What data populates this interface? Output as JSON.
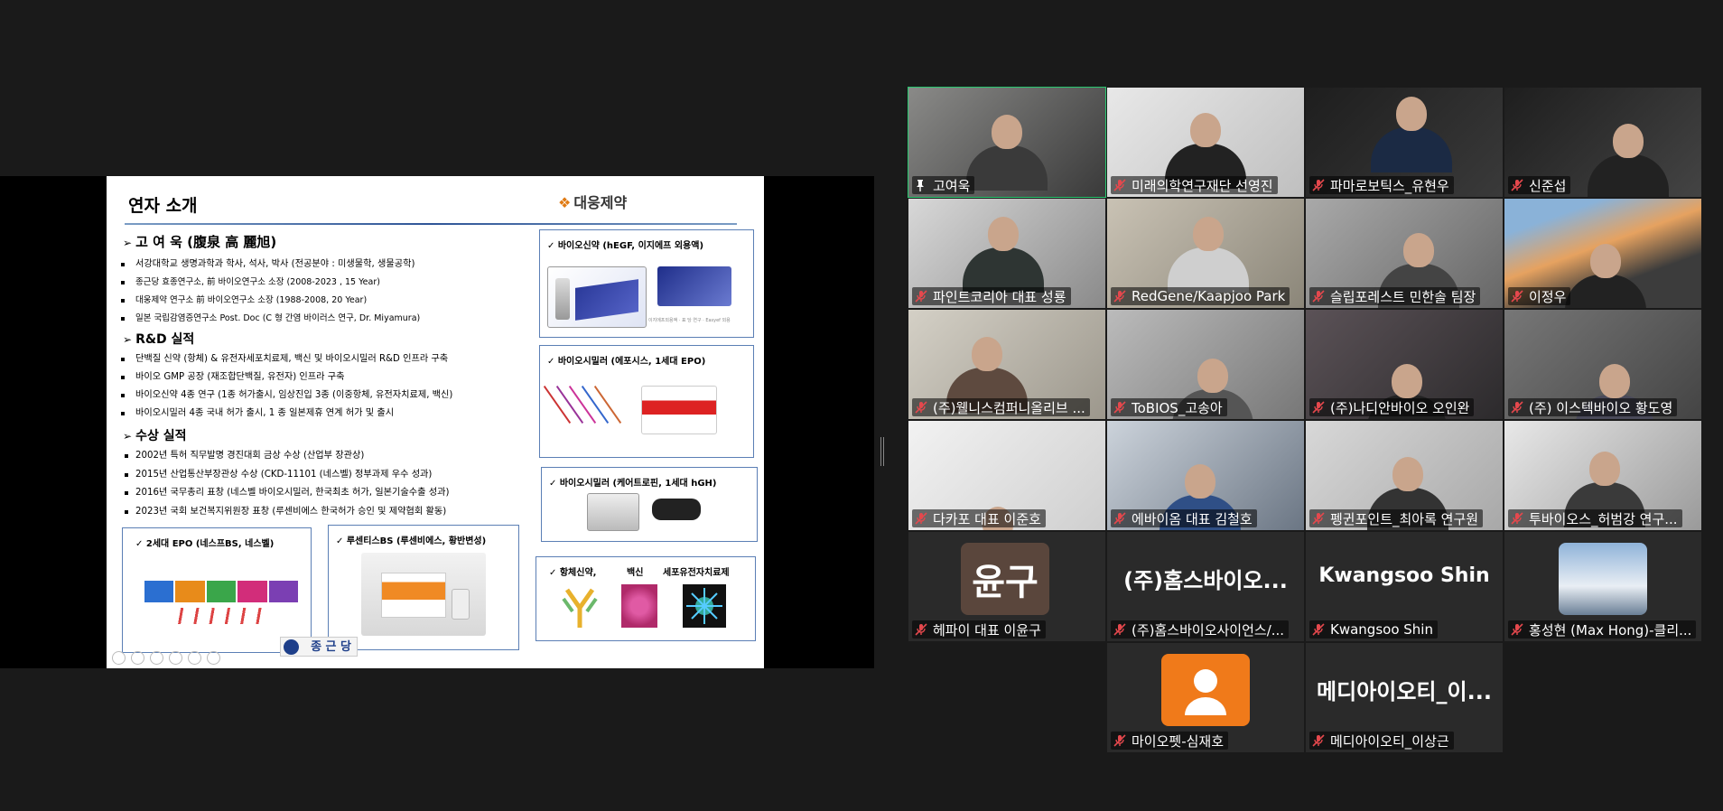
{
  "slide": {
    "title": "연자 소개",
    "company_logo": "대웅제약",
    "sections": [
      {
        "heading": "고  여  욱  (腹泉 高 麗旭)"
      },
      {
        "heading": "R&D 실적"
      },
      {
        "heading": "수상 실적"
      }
    ],
    "profile_items": [
      "서강대학교 생명과학과 학사, 석사, 박사  (전공분야 : 미생물학, 생물공학)",
      "종근당 효종연구소, 前 바이오연구소 소장 (2008-2023 , 15 Year)",
      "대웅제약 연구소 前 바이오연구소 소장  (1988-2008, 20 Year)",
      "일본 국립감염증연구소 Post. Doc (C 형 간염 바이러스 연구, Dr. Miyamura)"
    ],
    "rnd_items": [
      "단백질 신약 (항체) &  유전자세포치료제, 백신 및  바이오시밀러  R&D 인프라 구축",
      " 바이오 GMP  공장 (재조합단백질, 유전자)  인프라 구축",
      " 바이오신약  4종 연구 (1종 허가출시, 임상진입 3종 (이중항체, 유전자치료제, 백신)",
      " 바이오시밀러  4종  국내 허가 출시, 1 종 일본제휴 연계  허가 및 출시"
    ],
    "award_items": [
      "2002년 특허 직무발명 경진대회 금상 수상 (산업부 장관상)",
      "2015년 산업통산부장관상 수상 (CKD-11101 (네스벨) 정부과제 우수 성과)",
      "2016년 국무총리 표창 (네스벨 바이오시밀러, 한국최초 허가, 일본기술수출 성과)",
      "2023년 국회 보건복지위원장 표창 (루센비에스 한국허가 승인 및 제약협회 활동)"
    ],
    "boxes": {
      "bio_new_drug": "✓  바이오신약  (hEGF, 이지에프 외용액)",
      "bio_new_drug_caption": "이지에프외용액 · 표 당 연구 · Easyef 외용",
      "biosimilar_epo": "✓  바이오시밀러 (에포시스, 1세대 EPO)",
      "biosimilar_hgh": "✓  바이오시밀러  (케어트로핀, 1세대 hGH)",
      "epo2": "✓      2세대 EPO  (네스프BS,  네스벨)",
      "lucentis": "✓  루센티스BS   (루센비에스, 황반변성)",
      "pipeline_antibody": "✓  항체신약,",
      "pipeline_vaccine": "백신",
      "pipeline_gene": "세포유전자치료제"
    },
    "footer_logo": "종 근 당"
  },
  "participants": [
    {
      "name": "고여욱",
      "pinned": true,
      "muted": false,
      "active": true
    },
    {
      "name": "미래의학연구재단 선영진",
      "muted": true
    },
    {
      "name": "파마로보틱스_유현우",
      "muted": true
    },
    {
      "name": "신준섭",
      "muted": true
    },
    {
      "name": "파인트코리아 대표 성룡",
      "muted": true
    },
    {
      "name": "RedGene/Kaapjoo Park",
      "muted": true
    },
    {
      "name": "슬립포레스트 민한솔 팀장",
      "muted": true
    },
    {
      "name": "이정우",
      "muted": true
    },
    {
      "name": "(주)웰니스컴퍼니올리브 ...",
      "muted": true
    },
    {
      "name": "ToBIOS_고송아",
      "muted": true
    },
    {
      "name": "(주)나디안바이오 오인완",
      "muted": true
    },
    {
      "name": "(주) 이스텍바이오 황도영",
      "muted": true
    },
    {
      "name": "다카포 대표 이준호",
      "muted": true
    },
    {
      "name": "에바이옴 대표 김철호",
      "muted": true
    },
    {
      "name": "펭귄포인트_최아록 연구원",
      "muted": true
    },
    {
      "name": "투바이오스_허범강 연구...",
      "muted": true
    },
    {
      "name": "헤파이 대표 이윤구",
      "muted": true,
      "avatar_text": "윤구"
    },
    {
      "name": "(주)홈스바이오사이언스/...",
      "muted": true,
      "big_text": "(주)홈스바이오..."
    },
    {
      "name": "Kwangsoo Shin",
      "muted": true,
      "big_text": "Kwangsoo Shin"
    },
    {
      "name": "홍성현 (Max Hong)-클리...",
      "muted": true
    },
    {
      "name": "마이오펫-심재호",
      "muted": true
    },
    {
      "name": "메디아이오티_이상근",
      "muted": true,
      "big_text": "메디아이오티_이..."
    }
  ],
  "colors": {
    "active_speaker": "#28c76f",
    "muted_icon": "#e5484d",
    "background": "#1a1a1a"
  }
}
